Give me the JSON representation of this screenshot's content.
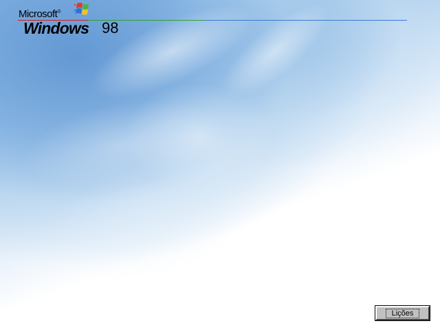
{
  "branding": {
    "company": "Microsoft",
    "trademark": "®",
    "product": "Windows",
    "version": "98",
    "rule_colors": [
      "#d02020",
      "#30a030",
      "#3a7ad8"
    ]
  },
  "flag": {
    "icon": "windows-flag-icon",
    "colors": [
      "#e53a1e",
      "#49b53a",
      "#2f6fd6",
      "#f4c51c"
    ]
  },
  "background": {
    "icon": "sky-clouds-background",
    "colors": [
      "#7fb0e0",
      "#b4d2ee",
      "#ffffff"
    ]
  },
  "footer": {
    "lessons_label": "Lições"
  }
}
